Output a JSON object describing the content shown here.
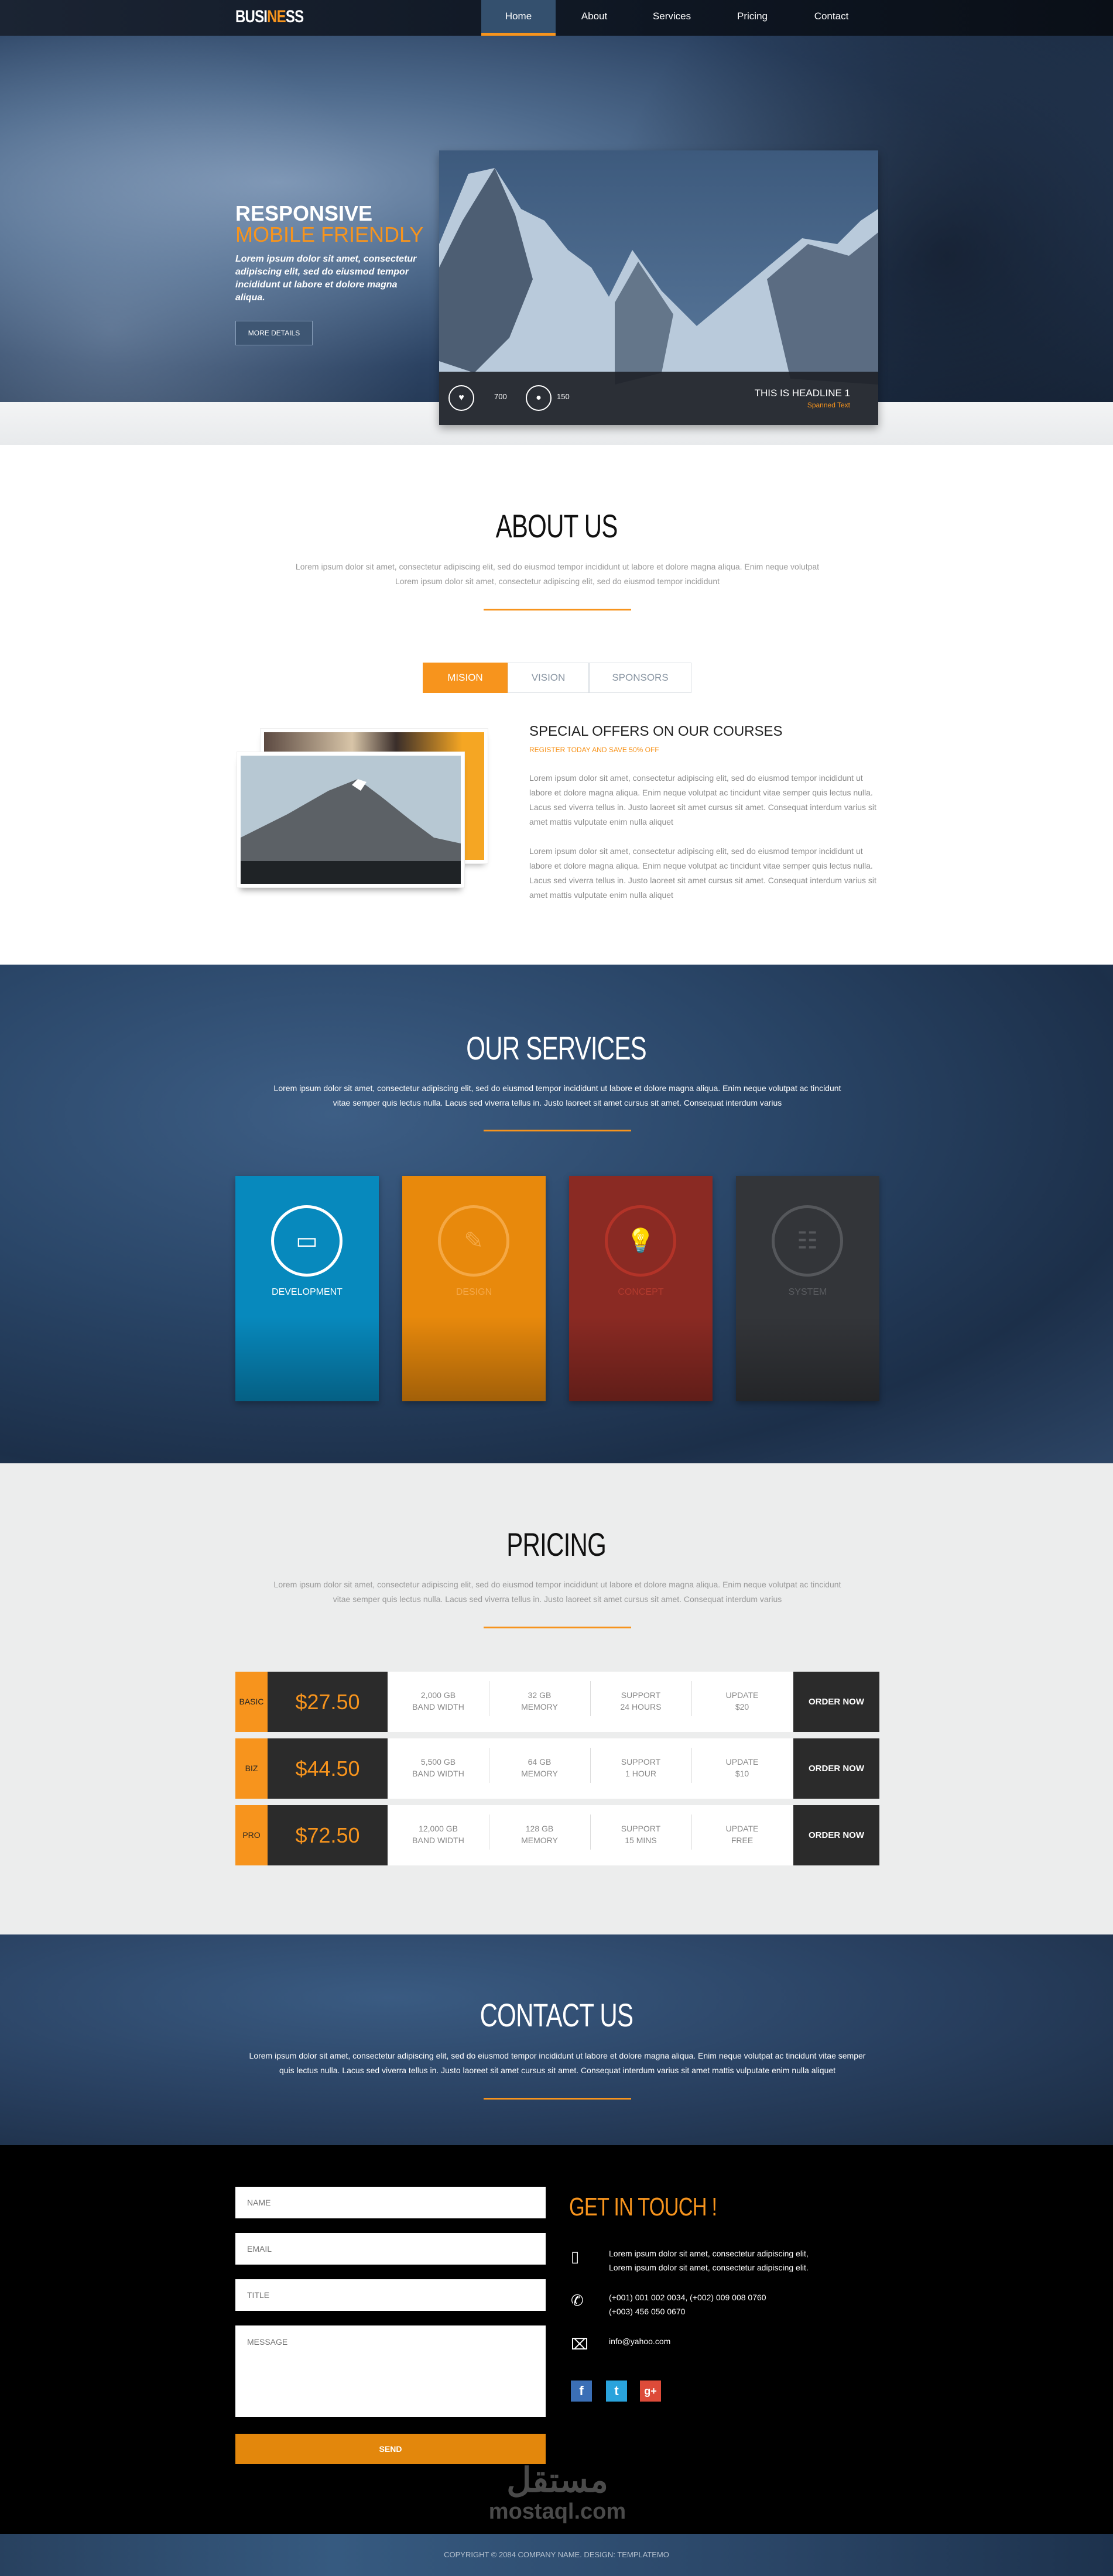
{
  "nav": {
    "logo_white": "BUSI",
    "logo_orange": "NE",
    "logo_end": "SS",
    "items": [
      {
        "label": "Home",
        "active": true
      },
      {
        "label": "About"
      },
      {
        "label": "Services"
      },
      {
        "label": "Pricing"
      },
      {
        "label": "Contact"
      }
    ]
  },
  "hero": {
    "title1": "RESPONSIVE",
    "title2": "MOBILE FRIENDLY",
    "text": "Lorem ipsum dolor sit amet, consectetur adipiscing elit, sed do eiusmod tempor incididunt ut labore et dolore magna aliqua.",
    "button": "MORE DETAILS",
    "card": {
      "likes": "700",
      "comments": "150",
      "headline": "THIS IS HEADLINE 1",
      "subline": "Spanned Text"
    }
  },
  "about": {
    "title": "ABOUT US",
    "text1": "Lorem ipsum dolor sit amet, consectetur adipiscing elit, sed do eiusmod tempor incididunt ut labore et dolore magna aliqua. Enim neque volutpat",
    "text2": "Lorem ipsum dolor sit amet, consectetur adipiscing elit, sed do eiusmod tempor incididunt",
    "tabs": [
      {
        "label": "MISION",
        "active": true
      },
      {
        "label": "VISION"
      },
      {
        "label": "SPONSORS"
      }
    ],
    "heading": "SPECIAL OFFERS ON OUR COURSES",
    "subheading": "REGISTER TODAY AND SAVE 50% OFF",
    "para1": "Lorem ipsum dolor sit amet, consectetur adipiscing elit, sed do eiusmod tempor incididunt ut labore et dolore magna aliqua. Enim neque volutpat ac tincidunt vitae semper quis lectus nulla. Lacus sed viverra tellus in. Justo laoreet sit amet cursus sit amet. Consequat interdum varius sit amet mattis vulputate enim nulla aliquet",
    "para2": "Lorem ipsum dolor sit amet, consectetur adipiscing elit, sed do eiusmod tempor incididunt ut labore et dolore magna aliqua. Enim neque volutpat ac tincidunt vitae semper quis lectus nulla. Lacus sed viverra tellus in. Justo laoreet sit amet cursus sit amet. Consequat interdum varius sit amet mattis vulputate enim nulla aliquet"
  },
  "services": {
    "title": "OUR SERVICES",
    "text": "Lorem ipsum dolor sit amet, consectetur adipiscing elit, sed do eiusmod tempor incididunt ut labore et dolore magna aliqua. Enim neque volutpat ac tincidunt vitae semper quis lectus nulla. Lacus sed viverra tellus in. Justo laoreet sit amet cursus sit amet. Consequat interdum varius",
    "cards": [
      {
        "label": "DEVELOPMENT",
        "icon": "monitor-icon",
        "color": "#0789bd"
      },
      {
        "label": "DESIGN",
        "icon": "pencil-icon",
        "color": "#e8890c"
      },
      {
        "label": "CONCEPT",
        "icon": "lightbulb-icon",
        "color": "#8a2a23"
      },
      {
        "label": "SYSTEM",
        "icon": "sliders-icon",
        "color": "#333539"
      }
    ]
  },
  "pricing": {
    "title": "PRICING",
    "text": "Lorem ipsum dolor sit amet, consectetur adipiscing elit, sed do eiusmod tempor incididunt ut labore et dolore magna aliqua. Enim neque volutpat ac tincidunt vitae semper quis lectus nulla. Lacus sed viverra tellus in. Justo laoreet sit amet cursus sit amet. Consequat interdum varius",
    "plans": [
      {
        "name": "BASIC",
        "price": "$27.50",
        "f": [
          [
            "2,000 GB",
            "BAND WIDTH"
          ],
          [
            "32 GB",
            "MEMORY"
          ],
          [
            "SUPPORT",
            "24 HOURS"
          ],
          [
            "UPDATE",
            "$20"
          ]
        ],
        "order": "ORDER NOW"
      },
      {
        "name": "BIZ",
        "price": "$44.50",
        "f": [
          [
            "5,500 GB",
            "BAND WIDTH"
          ],
          [
            "64 GB",
            "MEMORY"
          ],
          [
            "SUPPORT",
            "1 HOUR"
          ],
          [
            "UPDATE",
            "$10"
          ]
        ],
        "order": "ORDER NOW"
      },
      {
        "name": "PRO",
        "price": "$72.50",
        "f": [
          [
            "12,000 GB",
            "BAND WIDTH"
          ],
          [
            "128 GB",
            "MEMORY"
          ],
          [
            "SUPPORT",
            "15 MINS"
          ],
          [
            "UPDATE",
            "FREE"
          ]
        ],
        "order": "ORDER NOW"
      }
    ]
  },
  "contact": {
    "title": "CONTACT US",
    "text": "Lorem ipsum dolor sit amet, consectetur adipiscing elit, sed do eiusmod tempor incididunt ut labore et dolore magna aliqua. Enim neque volutpat ac tincidunt vitae semper quis lectus nulla. Lacus sed viverra tellus in. Justo laoreet sit amet cursus sit amet. Consequat interdum varius sit amet mattis vulputate enim nulla aliquet",
    "form": {
      "name": "NAME",
      "email": "EMAIL",
      "title": "TITLE",
      "message": "MESSAGE",
      "send": "SEND"
    },
    "touch": "GET IN TOUCH !",
    "address1": "Lorem ipsum dolor sit amet, consectetur adipiscing elit,",
    "address2": "Lorem ipsum dolor sit amet, consectetur adipiscing elit.",
    "phone1": "(+001) 001 002 0034, (+002) 009 008 0760",
    "phone2": "(+003) 456 050 0670",
    "email": "info@yahoo.com"
  },
  "watermark": {
    "arabic": "مستقل",
    "latin": "mostaql.com"
  },
  "footer": {
    "copyright": "COPYRIGHT © 2084 COMPANY NAME. DESIGN: TEMPLATEMO"
  },
  "colors": {
    "accent": "#f7941d",
    "dark": "#2b2b2b"
  }
}
